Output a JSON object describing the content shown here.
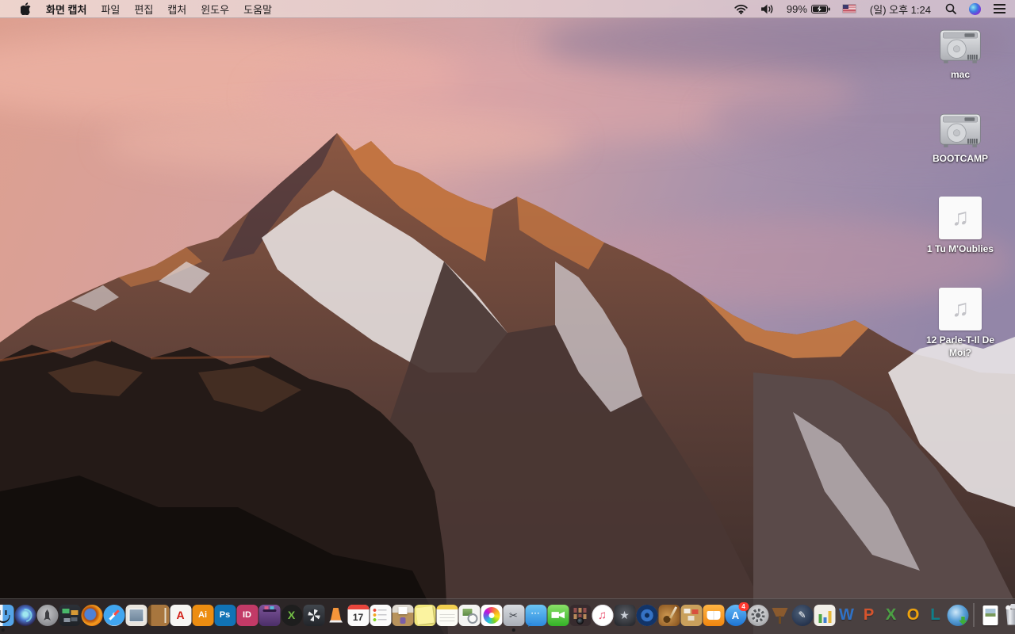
{
  "menu_bar": {
    "app_name": "화면 캡처",
    "menus": [
      "파일",
      "편집",
      "캡처",
      "윈도우",
      "도움말"
    ],
    "status": {
      "battery_percent": "99%",
      "battery_state": "charging",
      "clock": "(일) 오후 1:24",
      "icons": [
        "wifi",
        "volume",
        "battery-charging",
        "us-flag",
        "spotlight-search",
        "siri",
        "notification-center"
      ]
    }
  },
  "desktop": {
    "icons": [
      {
        "name": "volume-mac",
        "kind": "hdd",
        "label": "mac"
      },
      {
        "name": "volume-bootcamp",
        "kind": "hdd",
        "label": "BOOTCAMP"
      },
      {
        "name": "audio-file-1",
        "kind": "audio",
        "label": "1 Tu M'Oublies"
      },
      {
        "name": "audio-file-2",
        "kind": "audio",
        "label": "12 Parle-T-Il De Moi?"
      }
    ]
  },
  "dock": {
    "items": [
      {
        "name": "finder",
        "kind": "finder",
        "running": true
      },
      {
        "name": "siri",
        "kind": "siri"
      },
      {
        "name": "launchpad",
        "kind": "launchpad"
      },
      {
        "name": "mission-control",
        "kind": "mc"
      },
      {
        "name": "firefox",
        "kind": "firefox"
      },
      {
        "name": "safari",
        "kind": "safari"
      },
      {
        "name": "mail",
        "kind": "mail"
      },
      {
        "name": "contacts",
        "kind": "contacts"
      },
      {
        "name": "acrobat-reader",
        "kind": "tile",
        "label": "A",
        "bg": "#f7f6f3",
        "color": "#d11b12",
        "fs": 14
      },
      {
        "name": "illustrator",
        "kind": "tile",
        "label": "Ai",
        "bg": "#ec8d11",
        "color": "#ffffff",
        "fs": 11
      },
      {
        "name": "photoshop",
        "kind": "tile",
        "label": "Ps",
        "bg": "#1173b5",
        "color": "#ffffff",
        "fs": 11
      },
      {
        "name": "indesign",
        "kind": "tile",
        "label": "ID",
        "bg": "#c23a67",
        "color": "#ffffff",
        "fs": 11
      },
      {
        "name": "toast-titanium",
        "kind": "toast"
      },
      {
        "name": "x-sphere-app",
        "kind": "tile",
        "label": "X",
        "bg": "#1e1e1e",
        "color": "#74c046",
        "fs": 14,
        "circle": true
      },
      {
        "name": "fan-drive-utility",
        "kind": "fandrive"
      },
      {
        "name": "vlc",
        "kind": "vlc"
      },
      {
        "name": "calendar",
        "kind": "calendar",
        "label": "17"
      },
      {
        "name": "reminders",
        "kind": "reminders"
      },
      {
        "name": "archive-utility",
        "kind": "archive"
      },
      {
        "name": "stickies",
        "kind": "stickies"
      },
      {
        "name": "notes",
        "kind": "notes"
      },
      {
        "name": "preview",
        "kind": "preview"
      },
      {
        "name": "photos",
        "kind": "photos"
      },
      {
        "name": "screen-capture-grab",
        "kind": "grab",
        "label": "✂",
        "running": true
      },
      {
        "name": "messages",
        "kind": "messages",
        "label": "···"
      },
      {
        "name": "facetime",
        "kind": "facetime"
      },
      {
        "name": "photo-booth",
        "kind": "photobooth"
      },
      {
        "name": "itunes",
        "kind": "itunes",
        "label": "♫",
        "color": "#ea4e6d"
      },
      {
        "name": "imovie",
        "kind": "imovie",
        "label": "★",
        "color": "#c9ced6"
      },
      {
        "name": "dvd-player",
        "kind": "dvd"
      },
      {
        "name": "garageband",
        "kind": "garageband"
      },
      {
        "name": "scrapbook-kit",
        "kind": "kit"
      },
      {
        "name": "ibooks",
        "kind": "ibooks"
      },
      {
        "name": "app-store",
        "kind": "appstore",
        "label": "A",
        "color": "#ffffff",
        "badge": "4"
      },
      {
        "name": "system-preferences",
        "kind": "sysprefs"
      },
      {
        "name": "keynote",
        "kind": "keynote"
      },
      {
        "name": "pages",
        "kind": "pagesold",
        "label": "✎",
        "color": "#ffffff"
      },
      {
        "name": "numbers",
        "kind": "numbersold"
      },
      {
        "name": "word",
        "kind": "letter",
        "label": "W",
        "color": "#2e71c6"
      },
      {
        "name": "powerpoint",
        "kind": "letter",
        "label": "P",
        "color": "#d6532c"
      },
      {
        "name": "excel",
        "kind": "letter",
        "label": "X",
        "color": "#4ba043"
      },
      {
        "name": "outlook",
        "kind": "letter",
        "label": "O",
        "color": "#f0a30a"
      },
      {
        "name": "lync",
        "kind": "letter",
        "label": "L",
        "color": "#0e7f8a"
      },
      {
        "name": "download-globe",
        "kind": "globe"
      },
      {
        "name": "divider",
        "kind": "divider"
      },
      {
        "name": "document-stack",
        "kind": "docfile"
      },
      {
        "name": "trash",
        "kind": "trash"
      }
    ]
  }
}
